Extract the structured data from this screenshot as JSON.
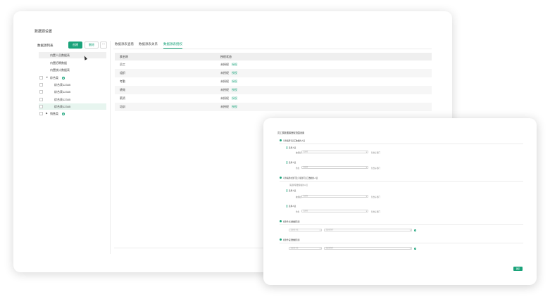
{
  "page": {
    "title": "数据源设置"
  },
  "left": {
    "title": "数据源列表",
    "create_label": "创建",
    "delete_label": "删除",
    "more_label": "⋯",
    "tree": [
      {
        "label": "内置人员数据表"
      },
      {
        "label": "内置招聘数据"
      },
      {
        "label": "内置统计数据表"
      },
      {
        "label": "综合类"
      },
      {
        "label": "综合表12345"
      },
      {
        "label": "综合表12345"
      },
      {
        "label": "综合表12345"
      },
      {
        "label": "综合表12345"
      },
      {
        "label": "销售类"
      }
    ]
  },
  "tabs": [
    {
      "label": "数据源表查看"
    },
    {
      "label": "数据源表关系"
    },
    {
      "label": "数据源表授权"
    }
  ],
  "table": {
    "headers": [
      "表名称",
      "授权状态"
    ],
    "rows": [
      {
        "name": "员工",
        "status": "未授权",
        "action": "授权"
      },
      {
        "name": "组织",
        "status": "未授权",
        "action": "授权"
      },
      {
        "name": "考勤",
        "status": "未授权",
        "action": "授权"
      },
      {
        "name": "绩效",
        "status": "未授权",
        "action": "授权"
      },
      {
        "name": "薪资",
        "status": "未授权",
        "action": "授权"
      },
      {
        "name": "培训",
        "status": "未授权",
        "action": "授权"
      }
    ]
  },
  "dialog": {
    "title": "员工表数据源授权范围设置",
    "sec1": "可查看所有员工数据的人员",
    "sub1": "选择人员",
    "sub2": "选择人员",
    "label_person": "被授权人",
    "label_role": "角色",
    "placeholder": "请选择",
    "dept": "包含子部门",
    "sec2": "可查看所在部门及下级部门员工数据的人员",
    "note": "请选择需要授权的人员",
    "sub3": "选择人员",
    "sub4": "选择人员",
    "sec3": "按条件过滤数据范围",
    "filter_ph": "请选择字段",
    "filter_ph2": "请选择条件",
    "sec4": "按条件设置数据范围",
    "filter_ph3": "请选择字段",
    "filter_ph4": "请选择条件",
    "ok_label": "确定"
  },
  "colors": {
    "accent": "#1aa37a"
  }
}
